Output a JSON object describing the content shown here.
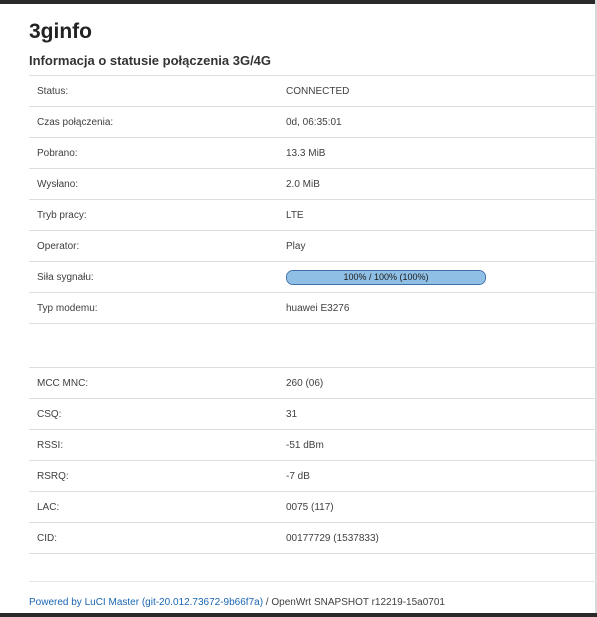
{
  "page": {
    "title": "3ginfo",
    "subtitle": "Informacja o statusie połączenia 3G/4G"
  },
  "status_table": [
    {
      "label": "Status:",
      "value": "CONNECTED"
    },
    {
      "label": "Czas połączenia:",
      "value": "0d, 06:35:01"
    },
    {
      "label": "Pobrano:",
      "value": "13.3 MiB"
    },
    {
      "label": "Wysłano:",
      "value": "2.0 MiB"
    },
    {
      "label": "Tryb pracy:",
      "value": "LTE"
    },
    {
      "label": "Operator:",
      "value": "Play"
    },
    {
      "label": "Siła sygnału:",
      "value": "100% / 100% (100%)",
      "level": 1.0
    },
    {
      "label": "Typ modemu:",
      "value": "huawei E3276"
    }
  ],
  "radio_table": [
    {
      "label": "MCC MNC:",
      "value": "260 (06)"
    },
    {
      "label": "CSQ:",
      "value": "31"
    },
    {
      "label": "RSSI:",
      "value": "-51 dBm"
    },
    {
      "label": "RSRQ:",
      "value": "-7 dB"
    },
    {
      "label": "LAC:",
      "value": "0075 (117)"
    },
    {
      "label": "CID:",
      "value": "00177729 (1537833)"
    }
  ],
  "footer": {
    "powered_link": "Powered by LuCI Master (git-20.012.73672-9b66f7a)",
    "separator": " / ",
    "version": "OpenWrt SNAPSHOT r12219-15a0701"
  },
  "colors": {
    "progress_fill": "#8fbfe4",
    "progress_border": "#3d6fa8",
    "link": "#1a66b3"
  }
}
